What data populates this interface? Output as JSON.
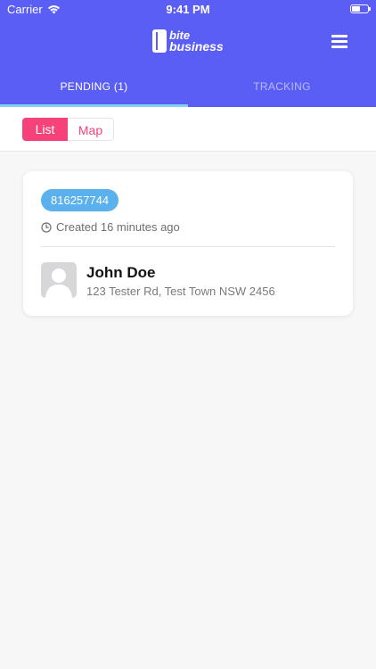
{
  "status_bar": {
    "carrier": "Carrier",
    "time": "9:41 PM"
  },
  "header": {
    "logo_line1": "bite",
    "logo_line2": "business",
    "background_color": "#5b5ef5"
  },
  "tabs": [
    {
      "label": "PENDING (1)",
      "active": true
    },
    {
      "label": "TRACKING",
      "active": false
    }
  ],
  "view_toggle": {
    "options": [
      "List",
      "Map"
    ],
    "selected": "List",
    "accent_color": "#f5427a"
  },
  "orders": [
    {
      "order_id": "816257744",
      "created": "Created 16 minutes ago",
      "customer_name": "John Doe",
      "customer_address": "123 Tester Rd, Test Town NSW 2456"
    }
  ],
  "icons": {
    "wifi": "wifi-icon",
    "battery": "battery-icon",
    "menu": "hamburger-menu-icon",
    "clock": "clock-icon",
    "avatar": "avatar-placeholder-icon"
  }
}
